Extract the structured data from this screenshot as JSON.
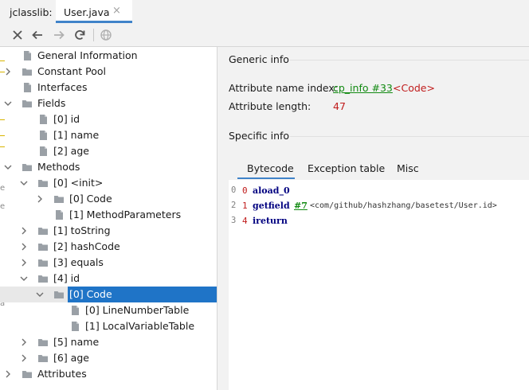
{
  "window": {
    "prefix": "jclasslib:",
    "tab": {
      "label": "User.java",
      "close": "×"
    }
  },
  "toolbar": {
    "buttons": [
      "close-icon",
      "back-icon",
      "forward-icon",
      "refresh-icon",
      "browser-icon"
    ]
  },
  "tree": {
    "gutter_chars": [
      "e",
      "e",
      "a"
    ],
    "items": [
      {
        "label": "General Information",
        "depth": 0,
        "expander": "none",
        "icon": "file"
      },
      {
        "label": "Constant Pool",
        "depth": 0,
        "expander": "collapsed",
        "icon": "folder"
      },
      {
        "label": "Interfaces",
        "depth": 0,
        "expander": "none",
        "icon": "file"
      },
      {
        "label": "Fields",
        "depth": 0,
        "expander": "expanded",
        "icon": "folder"
      },
      {
        "label": "[0] id",
        "depth": 1,
        "expander": "none",
        "icon": "file"
      },
      {
        "label": "[1] name",
        "depth": 1,
        "expander": "none",
        "icon": "file"
      },
      {
        "label": "[2] age",
        "depth": 1,
        "expander": "none",
        "icon": "file"
      },
      {
        "label": "Methods",
        "depth": 0,
        "expander": "expanded",
        "icon": "folder"
      },
      {
        "label": "[0] <init>",
        "depth": 1,
        "expander": "expanded",
        "icon": "folder"
      },
      {
        "label": "[0] Code",
        "depth": 2,
        "expander": "collapsed",
        "icon": "folder"
      },
      {
        "label": "[1] MethodParameters",
        "depth": 2,
        "expander": "none",
        "icon": "file"
      },
      {
        "label": "[1] toString",
        "depth": 1,
        "expander": "collapsed",
        "icon": "folder"
      },
      {
        "label": "[2] hashCode",
        "depth": 1,
        "expander": "collapsed",
        "icon": "folder"
      },
      {
        "label": "[3] equals",
        "depth": 1,
        "expander": "collapsed",
        "icon": "folder"
      },
      {
        "label": "[4] id",
        "depth": 1,
        "expander": "expanded",
        "icon": "folder"
      },
      {
        "label": "[0] Code",
        "depth": 2,
        "expander": "expanded",
        "icon": "folder",
        "selected": true
      },
      {
        "label": "[0] LineNumberTable",
        "depth": 3,
        "expander": "none",
        "icon": "file"
      },
      {
        "label": "[1] LocalVariableTable",
        "depth": 3,
        "expander": "none",
        "icon": "file"
      },
      {
        "label": "[5] name",
        "depth": 1,
        "expander": "collapsed",
        "icon": "folder"
      },
      {
        "label": "[6] age",
        "depth": 1,
        "expander": "collapsed",
        "icon": "folder"
      },
      {
        "label": "Attributes",
        "depth": 0,
        "expander": "collapsed",
        "icon": "folder"
      }
    ]
  },
  "generic_info": {
    "title": "Generic info",
    "name_index_label": "Attribute name index:",
    "name_index_link": "cp_info #33",
    "name_index_value": "<Code>",
    "length_label": "Attribute length:",
    "length_value": "47"
  },
  "specific_info": {
    "title": "Specific info",
    "tabs": [
      "Bytecode",
      "Exception table",
      "Misc"
    ],
    "active_tab": "Bytecode"
  },
  "bytecode": [
    {
      "line": "0",
      "offset": "0",
      "opcode": "aload_0",
      "ref": "",
      "comment": ""
    },
    {
      "line": "2",
      "offset": "1",
      "opcode": "getfield",
      "ref": "#7",
      "comment": "<com/github/hashzhang/basetest/User.id>"
    },
    {
      "line": "3",
      "offset": "4",
      "opcode": "ireturn",
      "ref": "",
      "comment": ""
    }
  ],
  "colors": {
    "accent": "#4083c9",
    "selection": "#1f74c7",
    "link": "#118a11",
    "value_red": "#c01c1c",
    "opcode_blue": "#000080"
  }
}
